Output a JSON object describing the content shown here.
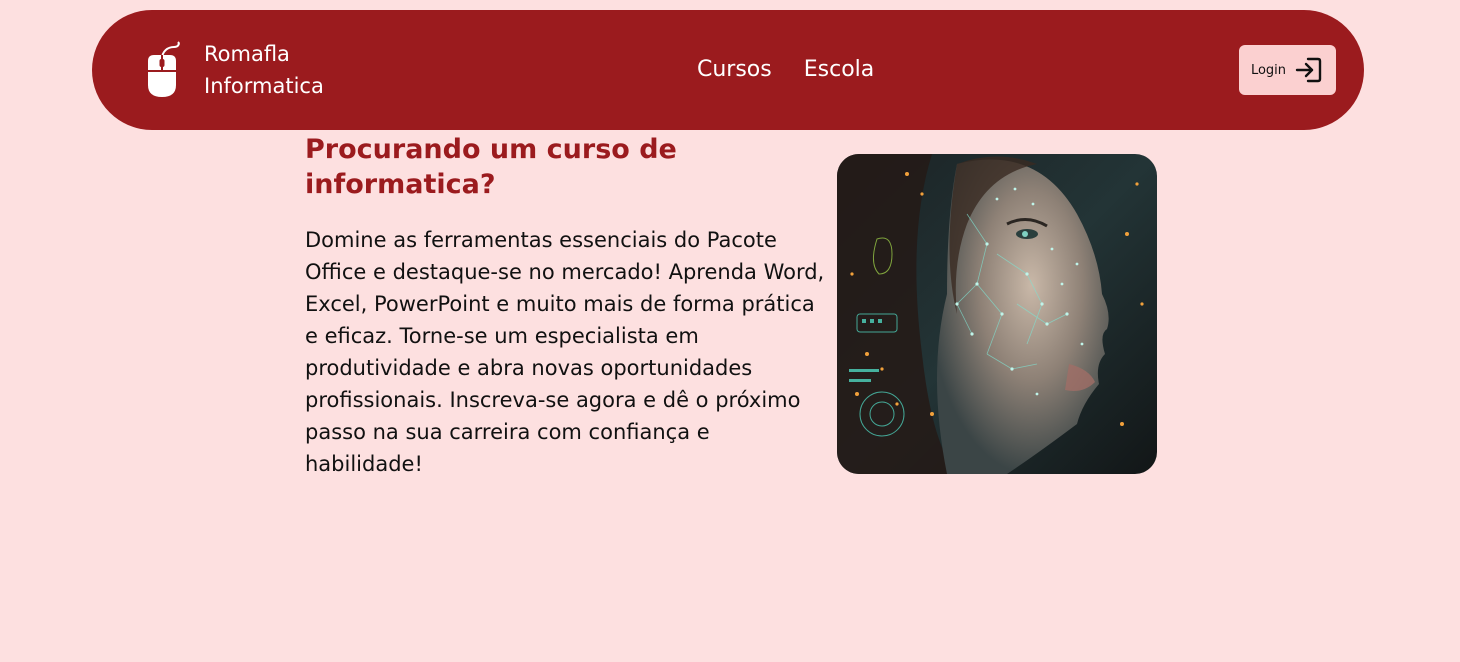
{
  "header": {
    "brand_name": "Romafla Informatica",
    "brand_icon": "computer-mouse-icon",
    "nav": [
      {
        "label": "Cursos"
      },
      {
        "label": "Escola"
      }
    ],
    "login": {
      "label": "Login",
      "icon": "login-arrow-icon"
    }
  },
  "hero": {
    "title": "Procurando um curso de informatica?",
    "text": "Domine as ferramentas essenciais do Pacote Office e destaque-se no mercado! Aprenda Word, Excel, PowerPoint e muito mais de forma prática e eficaz. Torne-se um especialista em produtividade e abra novas oportunidades profissionais. Inscreva-se agora e dê o próximo passo na sua carreira com confiança e habilidade!",
    "image": "digital-face-illustration"
  },
  "colors": {
    "page_background": "#fde0e0",
    "navbar": "#9b1b1e",
    "accent_text": "#9b1b1e",
    "login_button": "#fbd0d0"
  }
}
